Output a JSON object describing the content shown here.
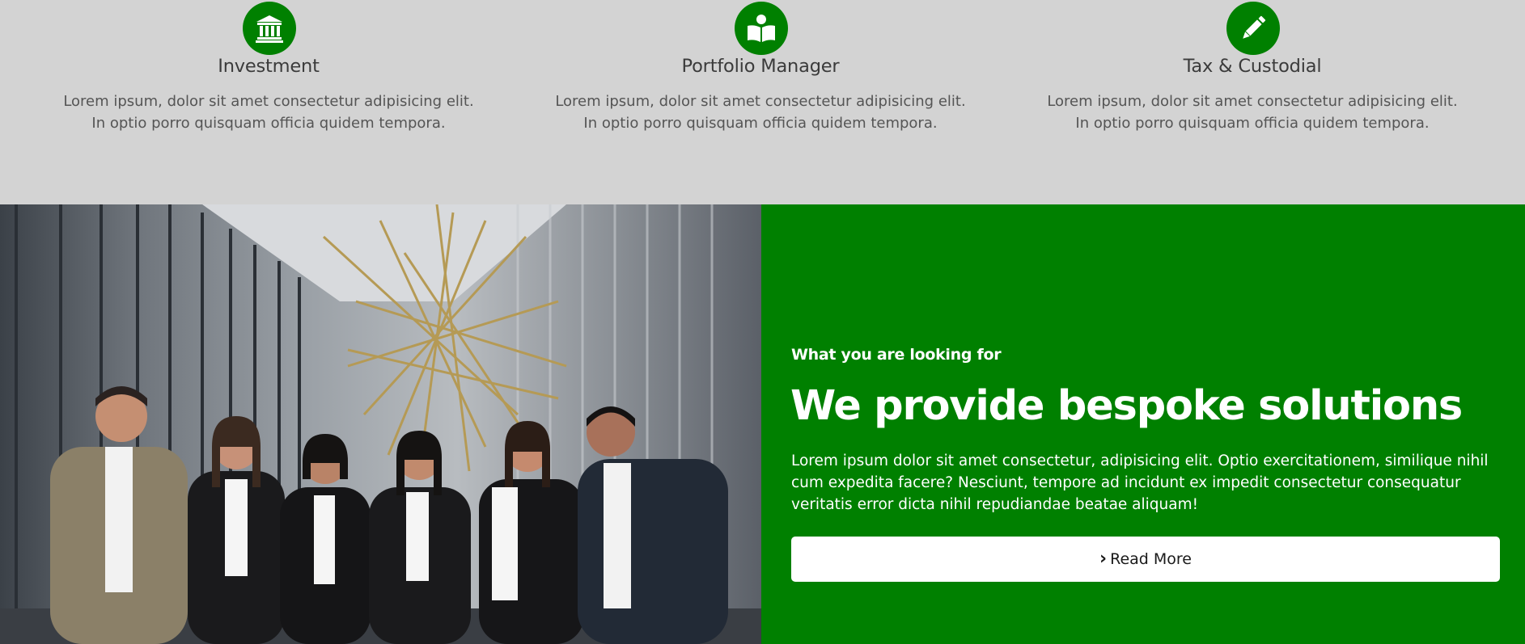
{
  "services": [
    {
      "icon": "bank-icon",
      "title": "Investment",
      "line1": "Lorem ipsum, dolor sit amet consectetur adipisicing elit.",
      "line2": "In optio porro quisquam officia quidem tempora."
    },
    {
      "icon": "reader-book-icon",
      "title": "Portfolio Manager",
      "line1": "Lorem ipsum, dolor sit amet consectetur adipisicing elit.",
      "line2": "In optio porro quisquam officia quidem tempora."
    },
    {
      "icon": "pencil-icon",
      "title": "Tax & Custodial",
      "line1": "Lorem ipsum, dolor sit amet consectetur adipisicing elit.",
      "line2": "In optio porro quisquam officia quidem tempora."
    }
  ],
  "promo": {
    "kicker": "What you are looking for",
    "heading": "We provide bespoke solutions",
    "body": "Lorem ipsum dolor sit amet consectetur, adipisicing elit. Optio exercitationem, similique nihil cum expedita facere? Nesciunt, tempore ad incidunt ex impedit consectetur consequatur veritatis error dicta nihil repudiandae beatae aliquam!",
    "button_label": "Read More",
    "button_icon": "chevron-right-icon"
  },
  "colors": {
    "accent": "#008000",
    "page_background": "#d3d3d3",
    "heading_text": "#3b3b3b",
    "body_text": "#555555"
  }
}
